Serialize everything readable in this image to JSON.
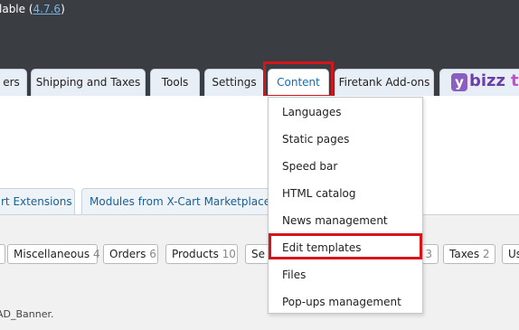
{
  "notice": {
    "text_before": "lable (",
    "version": "4.7.6",
    "text_after": ")"
  },
  "nav": {
    "tabs": [
      "ers",
      "Shipping and Taxes",
      "Tools",
      "Settings",
      "Content",
      "Firetank Add-ons"
    ],
    "addon_logo_letter": "y",
    "addon_name": "bizz",
    "addon_name_rest": "t"
  },
  "content_menu": {
    "items": [
      "Languages",
      "Static pages",
      "Speed bar",
      "HTML catalog",
      "News management",
      "Edit templates",
      "Files",
      "Pop-ups management"
    ],
    "highlighted": "Edit templates"
  },
  "subtabs": [
    "rt Extensions",
    "Modules from X-Cart Marketplace"
  ],
  "categories": [
    {
      "label": "Miscellaneous",
      "count": "4"
    },
    {
      "label": "Orders",
      "count": "6"
    },
    {
      "label": "Products",
      "count": "10"
    },
    {
      "label": "Se",
      "count": ""
    },
    {
      "label": "",
      "count": "3"
    },
    {
      "label": "Taxes",
      "count": "2"
    },
    {
      "label": "Us",
      "count": ""
    }
  ],
  "footnote": "AD_Banner.",
  "colors": {
    "highlight": "#d4151a",
    "link": "#0e6fb8",
    "topbar": "#3a3d42"
  }
}
